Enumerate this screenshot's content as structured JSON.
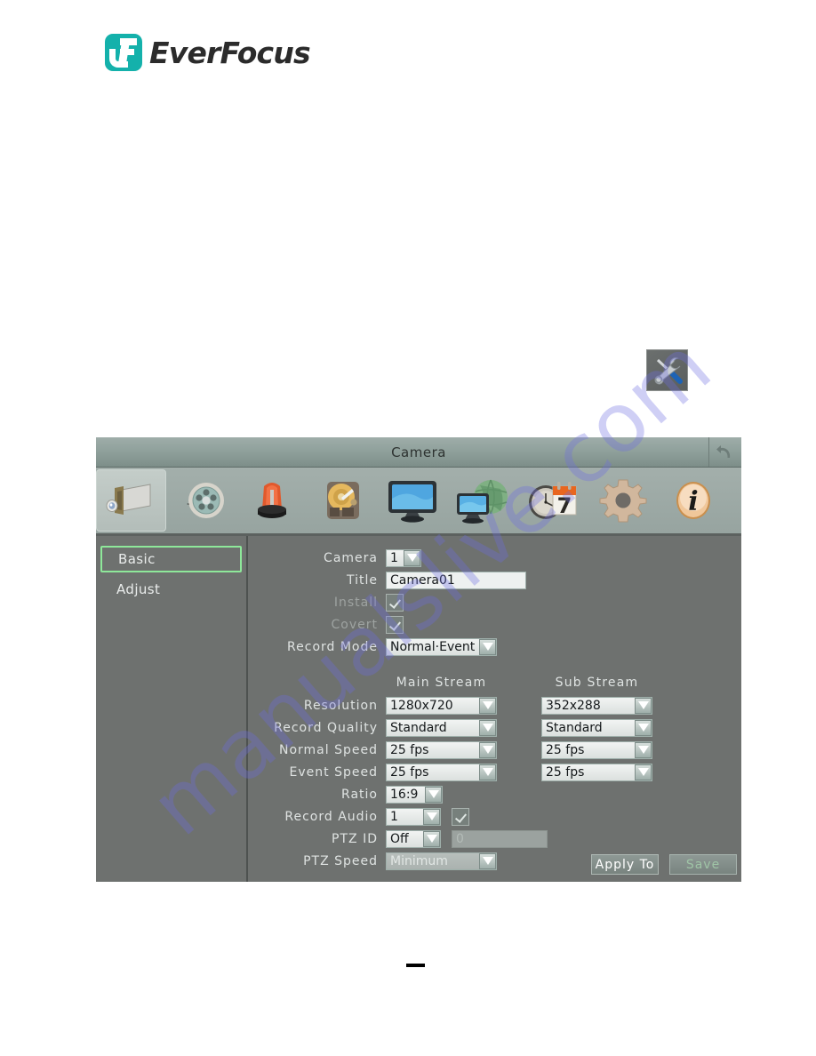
{
  "brand": {
    "name": "EverFocus",
    "logo_color": "#14b1ab"
  },
  "tools_icon": {
    "name": "tools-icon"
  },
  "watermark": {
    "text": "manualslive.com",
    "color": "#6c6ce2"
  },
  "window": {
    "title": "Camera",
    "back_icon": "back-arrow-icon",
    "toolbar": [
      {
        "name": "camera-icon",
        "label": "Camera",
        "selected": true
      },
      {
        "name": "film-reel-icon",
        "label": "Record",
        "selected": false
      },
      {
        "name": "alarm-beacon-icon",
        "label": "Alarm",
        "selected": false
      },
      {
        "name": "hard-disk-icon",
        "label": "Disk",
        "selected": false
      },
      {
        "name": "monitor-icon",
        "label": "Display",
        "selected": false
      },
      {
        "name": "network-globe-icon",
        "label": "Network",
        "selected": false
      },
      {
        "name": "clock-calendar-icon",
        "label": "Date/Time",
        "selected": false
      },
      {
        "name": "gear-icon",
        "label": "System",
        "selected": false
      },
      {
        "name": "info-icon",
        "label": "Information",
        "selected": false
      }
    ]
  },
  "sidebar": {
    "items": [
      {
        "label": "Basic",
        "active": true
      },
      {
        "label": "Adjust",
        "active": false
      }
    ]
  },
  "form": {
    "camera": {
      "label": "Camera",
      "value": "1"
    },
    "title": {
      "label": "Title",
      "value": "Camera01"
    },
    "install": {
      "label": "Install",
      "checked": true
    },
    "covert": {
      "label": "Covert",
      "checked": true
    },
    "record_mode": {
      "label": "Record Mode",
      "value": "Normal·Event"
    },
    "stream_headers": {
      "main": "Main Stream",
      "sub": "Sub Stream"
    },
    "resolution": {
      "label": "Resolution",
      "main": "1280x720",
      "sub": "352x288"
    },
    "record_quality": {
      "label": "Record Quality",
      "main": "Standard",
      "sub": "Standard"
    },
    "normal_speed": {
      "label": "Normal Speed",
      "main": "25 fps",
      "sub": "25 fps"
    },
    "event_speed": {
      "label": "Event Speed",
      "main": "25 fps",
      "sub": "25 fps"
    },
    "ratio": {
      "label": "Ratio",
      "value": "16:9"
    },
    "record_audio": {
      "label": "Record Audio",
      "value": "1",
      "checked": true
    },
    "ptz_id": {
      "label": "PTZ ID",
      "value": "Off",
      "field_value": "0"
    },
    "ptz_speed": {
      "label": "PTZ Speed",
      "value": "Minimum"
    }
  },
  "buttons": {
    "apply_to": "Apply To",
    "save": "Save"
  }
}
